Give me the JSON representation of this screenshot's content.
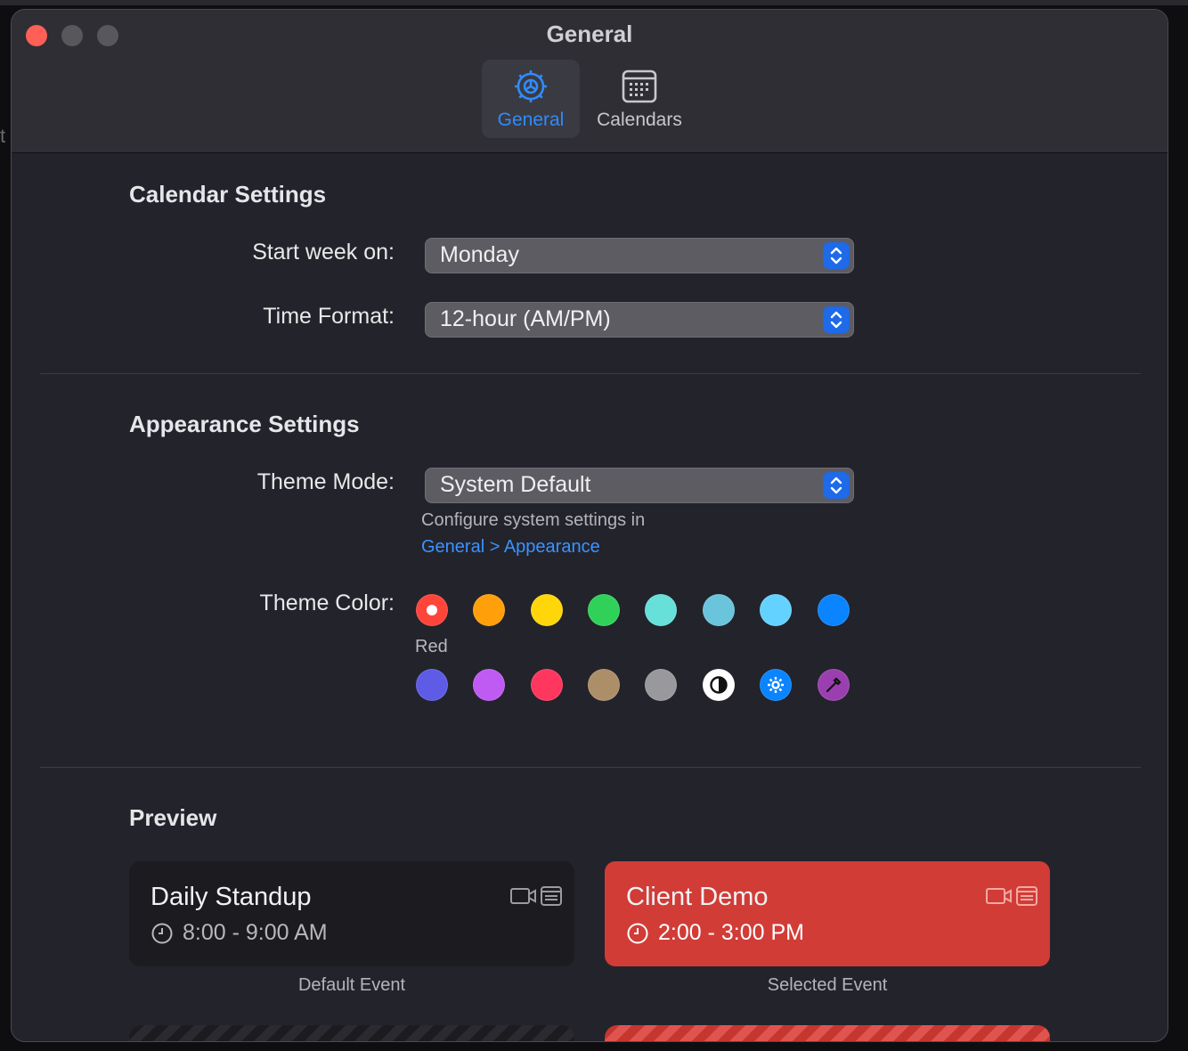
{
  "desktop": {
    "edge_text": "t"
  },
  "window": {
    "title": "General"
  },
  "toolbar": {
    "tabs": [
      {
        "label": "General",
        "icon": "gear-icon",
        "selected": true
      },
      {
        "label": "Calendars",
        "icon": "calendar-icon",
        "selected": false
      }
    ]
  },
  "calendar_settings": {
    "title": "Calendar Settings",
    "start_week": {
      "label": "Start week on:",
      "value": "Monday"
    },
    "time_format": {
      "label": "Time Format:",
      "value": "12-hour (AM/PM)"
    }
  },
  "appearance": {
    "title": "Appearance Settings",
    "theme_mode": {
      "label": "Theme Mode:",
      "value": "System Default",
      "hint": "Configure system settings in",
      "link": "General > Appearance"
    },
    "theme_color": {
      "label": "Theme Color:",
      "selected_name": "Red",
      "swatches": [
        {
          "name": "red",
          "color": "#ff453a",
          "selected": true
        },
        {
          "name": "orange",
          "color": "#ff9f0a"
        },
        {
          "name": "yellow",
          "color": "#ffd60a"
        },
        {
          "name": "green",
          "color": "#30d158"
        },
        {
          "name": "mint",
          "color": "#66e0d8"
        },
        {
          "name": "teal",
          "color": "#6ac4dc"
        },
        {
          "name": "cyan",
          "color": "#64d2ff"
        },
        {
          "name": "blue",
          "color": "#0a84ff"
        },
        {
          "name": "indigo",
          "color": "#5e5ce6"
        },
        {
          "name": "purple",
          "color": "#bf5af2"
        },
        {
          "name": "pink",
          "color": "#ff375f"
        },
        {
          "name": "brown",
          "color": "#ac8e68"
        },
        {
          "name": "gray",
          "color": "#98989d"
        },
        {
          "name": "contrast",
          "color": "#ffffff",
          "icon": "contrast-icon"
        },
        {
          "name": "system",
          "color": "#0a84ff",
          "icon": "gear-icon"
        },
        {
          "name": "custom",
          "color": "#9b3fb0",
          "icon": "eyedropper-icon"
        }
      ]
    }
  },
  "preview": {
    "title": "Preview",
    "default_event": {
      "title": "Daily Standup",
      "time": "8:00 - 9:00 AM",
      "caption": "Default Event"
    },
    "selected_event": {
      "title": "Client Demo",
      "time": "2:00 - 3:00 PM",
      "caption": "Selected Event"
    }
  }
}
